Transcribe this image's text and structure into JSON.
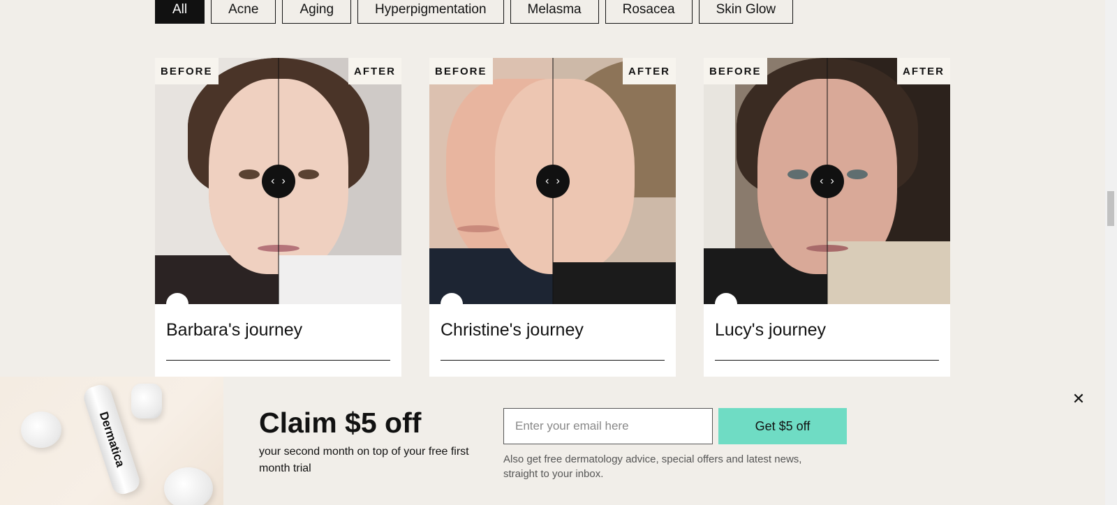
{
  "filters": [
    "All",
    "Acne",
    "Aging",
    "Hyperpigmentation",
    "Melasma",
    "Rosacea",
    "Skin Glow"
  ],
  "slider": {
    "before_label": "BEFORE",
    "after_label": "AFTER",
    "prev_glyph": "‹",
    "next_glyph": "›"
  },
  "cards": [
    {
      "title": "Barbara's journey"
    },
    {
      "title": "Christine's journey"
    },
    {
      "title": "Lucy's journey"
    }
  ],
  "promo": {
    "product_label": "Dermatica",
    "heading": "Claim $5 off",
    "subheading": "your second month on top of your free first month trial",
    "email_placeholder": "Enter your email here",
    "cta_label": "Get $5 off",
    "note": "Also get free dermatology advice, special offers and latest news, straight to your inbox.",
    "close_glyph": "✕"
  },
  "colors": {
    "page_bg": "#f1eee9",
    "cta_bg": "#6fdcc4",
    "active_chip_bg": "#111111"
  }
}
